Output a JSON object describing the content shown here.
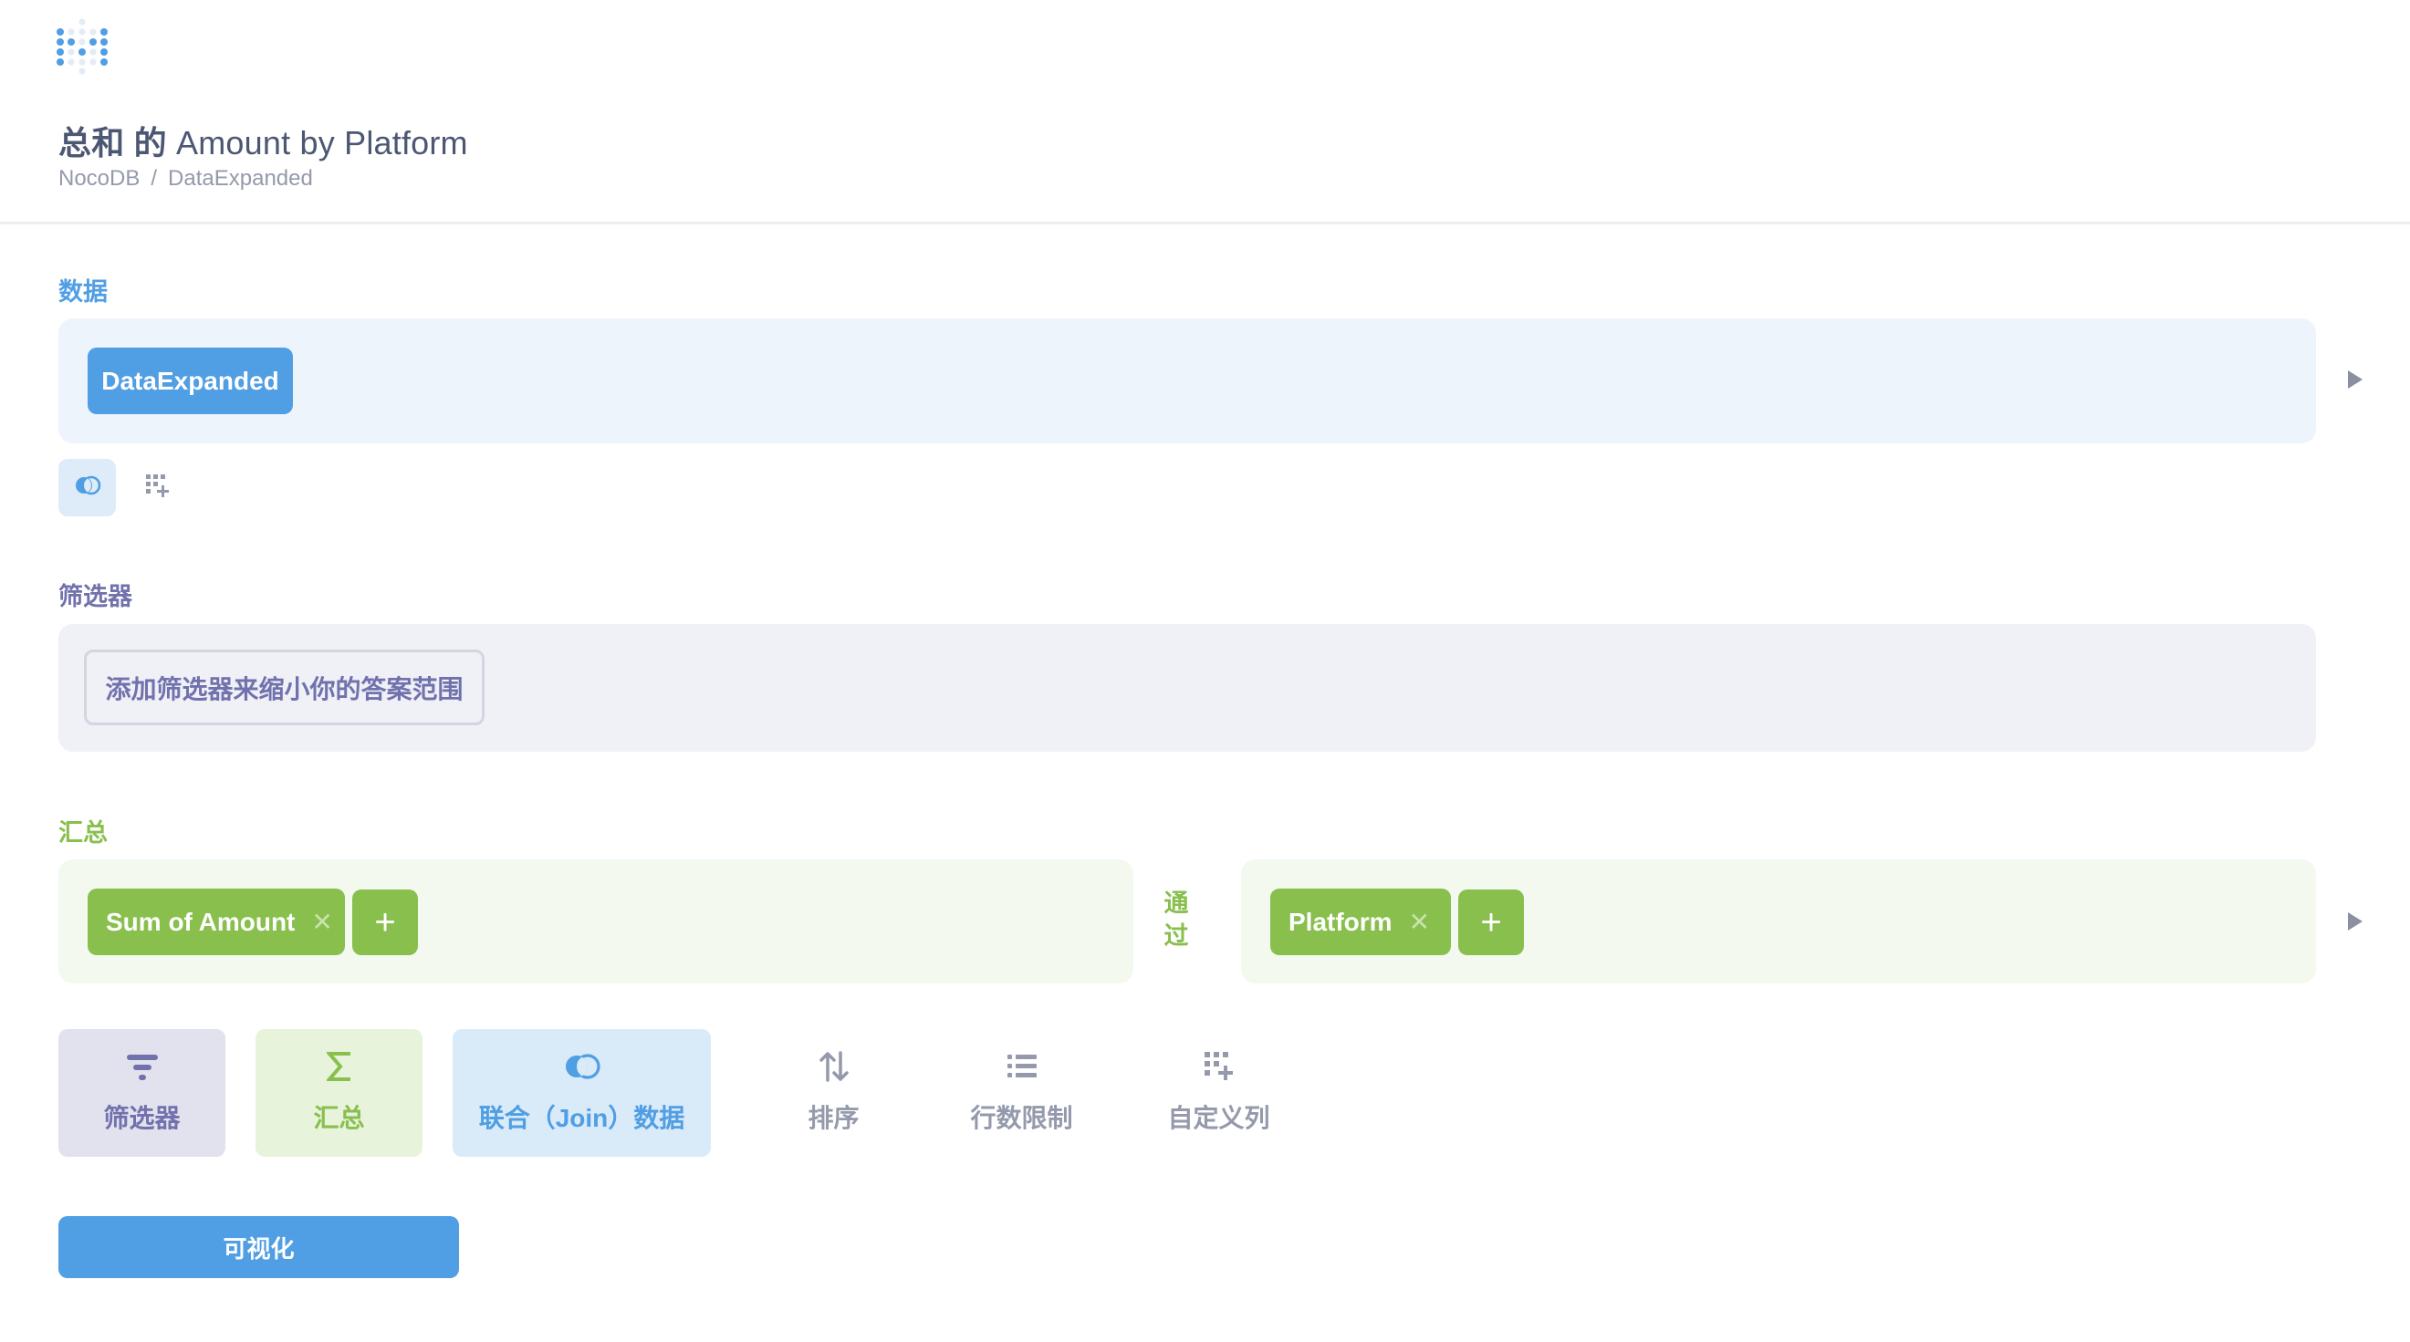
{
  "header": {
    "logo": "metabase-logo",
    "title_prefix": "总和 的",
    "title_suffix": "Amount by Platform",
    "breadcrumb": [
      "NocoDB",
      "/",
      "DataExpanded"
    ]
  },
  "sections": {
    "data": {
      "label": "数据",
      "table": "DataExpanded",
      "join_icon": "join-icon",
      "custom_column_icon": "custom-column-icon",
      "expand_icon": "play-arrow-icon"
    },
    "filter": {
      "label": "筛选器",
      "placeholder_button": "添加筛选器来缩小你的答案范围"
    },
    "summarize": {
      "label": "汇总",
      "metrics": [
        {
          "label": "Sum of Amount",
          "remove_icon": "close-icon"
        }
      ],
      "add_metric_icon": "plus-icon",
      "by_label_lines": [
        "通",
        "过"
      ],
      "breakouts": [
        {
          "label": "Platform",
          "remove_icon": "close-icon"
        }
      ],
      "add_breakout_icon": "plus-icon",
      "expand_icon": "play-arrow-icon"
    }
  },
  "actions": [
    {
      "id": "filter",
      "label": "筛选器",
      "icon": "filter-icon"
    },
    {
      "id": "summarize",
      "label": "汇总",
      "icon": "sigma-icon"
    },
    {
      "id": "join",
      "label": "联合（Join）数据",
      "icon": "join-icon"
    },
    {
      "id": "sort",
      "label": "排序",
      "icon": "sort-icon"
    },
    {
      "id": "limit",
      "label": "行数限制",
      "icon": "list-icon"
    },
    {
      "id": "custom-column",
      "label": "自定义列",
      "icon": "custom-column-icon"
    }
  ],
  "visualize_button": "可视化",
  "colors": {
    "brand": "#509ee3",
    "filter": "#7172ad",
    "summarize": "#88bf4d",
    "text": "#4c5773",
    "muted": "#949aab"
  }
}
